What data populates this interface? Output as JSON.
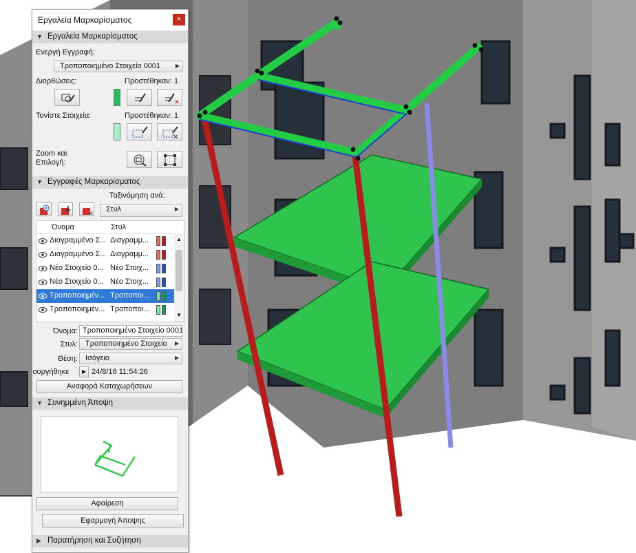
{
  "palette": {
    "title": "Εργαλεία Μαρκαρίσματος",
    "close_label": "×",
    "tools_section": {
      "title": "Εργαλεία Μαρκαρίσματος",
      "active_entry_label": "Ενεργή Εγγραφή:",
      "active_entry_value": "Τροποποιημένο Στοιχείο 0001",
      "corrections_label": "Διορθώσεις:",
      "corrections_added": "Προστέθηκαν: 1",
      "highlight_label": "Τονίστε Στοιχεία:",
      "highlight_added": "Προστέθηκαν: 1",
      "zoom_label_line1": "Zoom και",
      "zoom_label_line2": "Επιλογή:"
    },
    "entries_section": {
      "title": "Εγγραφές Μαρκαρίσματος",
      "sort_label": "Ταξινόμηση ανά:",
      "sort_value": "Στυλ",
      "columns": [
        "Όνομα",
        "Στυλ"
      ],
      "rows": [
        {
          "name": "Διαγραμμένο Σ...",
          "style": "Διαγραμμ...",
          "color1": "#e06868",
          "color2": "#c01818",
          "selected": false
        },
        {
          "name": "Διαγραμμένο Σ...",
          "style": "Διαγραμμ...",
          "color1": "#e06868",
          "color2": "#c01818",
          "selected": false
        },
        {
          "name": "Νέο Στοιχείο 0...",
          "style": "Νέο Στοιχ...",
          "color1": "#7a9ee0",
          "color2": "#1e4fb8",
          "selected": false
        },
        {
          "name": "Νέο Στοιχείο 0...",
          "style": "Νέο Στοιχ...",
          "color1": "#7a9ee0",
          "color2": "#1e4fb8",
          "selected": false
        },
        {
          "name": "Τροποποιημέν...",
          "style": "Τροποποι...",
          "color1": "#7fe0a8",
          "color2": "#14a050",
          "selected": true
        },
        {
          "name": "Τροποποιημέν...",
          "style": "Τροποποι...",
          "color1": "#7fe0a8",
          "color2": "#14a050",
          "selected": false
        }
      ],
      "name_label": "Όνομα:",
      "name_value": "Τροποποιημένο Στοιχείο 0001",
      "style_label": "Στυλ:",
      "style_value": "Τροποποιημένο Στοιχείο",
      "position_label": "Θέση:",
      "position_value": "Ισόγειο",
      "created_label": "ιουργήθηκε",
      "created_value": "24/8/16 11:54:26",
      "report_button": "Αναφορά Καταχωρήσεων"
    },
    "view_section": {
      "title": "Συνημμένη Άποψη",
      "remove_button": "Αφαίρεση",
      "apply_button": "Εφαρμογή Άποψης"
    },
    "comments_section": {
      "title": "Παρατήρηση και Συζήτηση"
    }
  },
  "colors": {
    "correction_swatch": "#1fbf5a",
    "highlight_swatch": "#a8f0c8",
    "selection": "#3079d6",
    "markup_green": "#22cc44",
    "deleted_red": "#cc2020",
    "new_blue": "#8a8ae8"
  },
  "icons": {
    "corrections_tools": [
      "edit-markup-icon",
      "add-correction-icon",
      "remove-correction-icon"
    ],
    "highlight_tools": [
      "add-highlight-icon",
      "remove-highlight-icon"
    ],
    "zoom_tools": [
      "zoom-icon",
      "select-icon"
    ],
    "entry_tools": [
      "new-entry-icon",
      "import-entry-icon",
      "delete-entry-icon"
    ]
  }
}
